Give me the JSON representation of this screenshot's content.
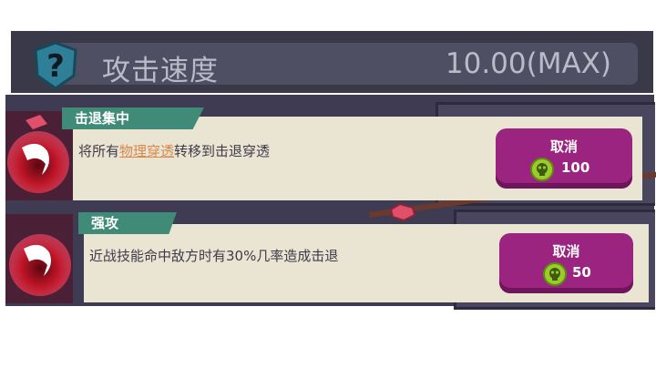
{
  "stat": {
    "name": "攻击速度",
    "value": "10.00(MAX)"
  },
  "icons": {
    "help": "question-mark-icon",
    "skill": "red-swirl-skill-icon",
    "cost": "green-skull-coin-icon"
  },
  "skills": [
    {
      "tag": "击退集中",
      "desc_before": "将所有",
      "desc_highlight": "物理穿透",
      "desc_after": "转移到击退穿透",
      "button_label": "取消",
      "cost": "100"
    },
    {
      "tag": "强攻",
      "desc": "近战技能命中敌方时有30%几率造成击退",
      "button_label": "取消",
      "cost": "50"
    }
  ],
  "colors": {
    "tag": "#3f8b78",
    "button": "#9a2480",
    "highlight": "#d8884a",
    "coin": "#9acd2a"
  }
}
